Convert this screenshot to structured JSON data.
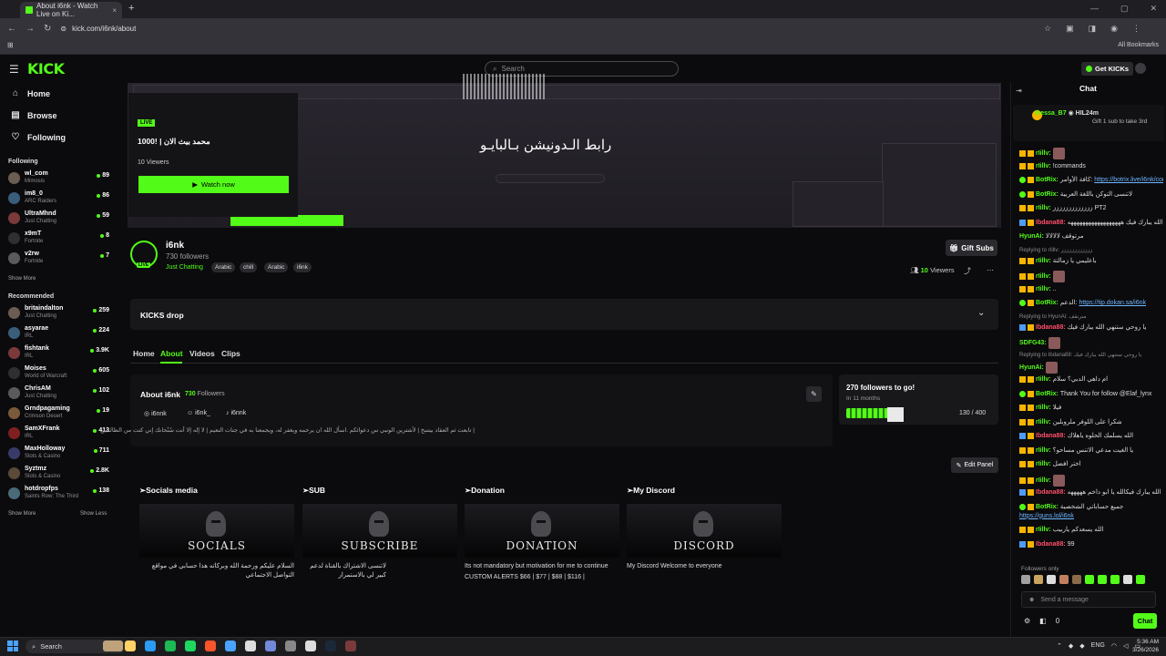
{
  "browser": {
    "tab_title": "About i6nk - Watch Live on Ki...",
    "tab_close": "×",
    "new_tab": "+",
    "url": "kick.com/i6nk/about",
    "all_bookmarks": "All Bookmarks",
    "window_controls": [
      "—",
      "▢",
      "✕"
    ]
  },
  "header": {
    "logo": "KICK",
    "search_placeholder": "Search",
    "get_kicks": "Get KICKs"
  },
  "sidebar": {
    "nav": [
      {
        "label": "Home",
        "icon": "home-icon"
      },
      {
        "label": "Browse",
        "icon": "browse-icon"
      },
      {
        "label": "Following",
        "icon": "heart-icon"
      }
    ],
    "following_heading": "Following",
    "following": [
      {
        "name": "wl_com",
        "game": "Mimosis",
        "viewers": "89"
      },
      {
        "name": "im8_0",
        "game": "ARC Raiders",
        "viewers": "86"
      },
      {
        "name": "UltraMhnd",
        "game": "Just Chatting",
        "viewers": "59"
      },
      {
        "name": "x9mT",
        "game": "Fortnite",
        "viewers": "8"
      },
      {
        "name": "v2rw",
        "game": "Fortnite",
        "viewers": "7"
      }
    ],
    "show_more": "Show More",
    "recommended_heading": "Recommended",
    "recommended": [
      {
        "name": "britaindalton",
        "game": "Just Chatting",
        "viewers": "259"
      },
      {
        "name": "asyarae",
        "game": "IRL",
        "viewers": "224"
      },
      {
        "name": "fishtank",
        "game": "IRL",
        "viewers": "3.9K"
      },
      {
        "name": "Moises",
        "game": "World of Warcraft",
        "viewers": "605"
      },
      {
        "name": "ChrisAM",
        "game": "Just Chatting",
        "viewers": "102"
      },
      {
        "name": "Grndpagaming",
        "game": "Crimson Desert",
        "viewers": "19"
      },
      {
        "name": "SamXFrank",
        "game": "IRL",
        "viewers": "413"
      },
      {
        "name": "MaxHolloway",
        "game": "Slots & Casino",
        "viewers": "711"
      },
      {
        "name": "Syztmz",
        "game": "Slots & Casino",
        "viewers": "2.8K"
      },
      {
        "name": "hotdropfps",
        "game": "Saints Row: The Third",
        "viewers": "138"
      }
    ],
    "show_more2": "Show More",
    "show_less": "Show Less"
  },
  "banner": {
    "live_badge": "LIVE",
    "stream_title": "1000! | محمد بيث الان",
    "viewers": "10 Viewers",
    "watch_now": "Watch now",
    "arabic_overlay": "رابط الـدونيشن بـالبايـو"
  },
  "channel": {
    "name": "i6nk",
    "followers": "730 followers",
    "live": "LIVE",
    "category": "Just Chatting",
    "tags": [
      "Arabic",
      "chill",
      "Arabic",
      "i6nk"
    ],
    "gift_subs": "Gift Subs",
    "viewers_count": "10",
    "viewers_label": "Viewers"
  },
  "kicks_drop": "KICKS drop",
  "tabs": [
    "Home",
    "About",
    "Videos",
    "Clips"
  ],
  "about": {
    "title": "About i6nk",
    "followers_num": "730",
    "followers_label": "Followers",
    "socials": [
      "i6nnk",
      "i6nk_",
      "i6nnk"
    ],
    "bio": "| تابعت ثم العقاد بيتنبخ | لأشترين الونبي س دعوائكم .اسأل الله ان يرحمه ويغفر له، ويجمعنا به في جنات النعيم | لا إله إلا أنت سُبْحانك إني كنت من الظالمين"
  },
  "goal": {
    "title": "270 followers to go!",
    "sub": "In 11 months",
    "progress": "130 / 400",
    "fraction": 0.325
  },
  "edit_panel": "Edit Panel",
  "panels": [
    {
      "title": "➢Socials media",
      "image_word": "SOCIALS",
      "desc": "السلام عليكم ورحمة الله وبركاته هذا حسابي في مواقع التواصل الاجتماعي"
    },
    {
      "title": "➢SUB",
      "image_word": "SUBSCRIBE",
      "desc": "لاتنسى الاشتراك بالقناة لدعم كبير لي بالاستمرار"
    },
    {
      "title": "➢Donation",
      "image_word": "DONATION",
      "desc": "Its not mandatory but motivation for me to continue",
      "desc2": "CUSTOM ALERTS $66 | $77 | $88 | $116 |"
    },
    {
      "title": "➢My Discord",
      "image_word": "DISCORD",
      "desc": "My Discord Welcome to everyone"
    }
  ],
  "chat": {
    "title": "Chat",
    "pinned_user": "Ihessa_B7",
    "pinned_gift": "HIL24m",
    "pinned_text": "Gift 1 sub to take 3rd",
    "messages": [
      {
        "user": "rIillv:",
        "text": "",
        "badge": "b1",
        "color": "#53fc18"
      },
      {
        "user": "rIillv:",
        "text": "!commands",
        "badge": "b1",
        "color": "#53fc18"
      },
      {
        "user": "BotRix:",
        "text": "كافة الأوامر:",
        "badge": "b3",
        "color": "#53fc18",
        "link": "https://botrix.live/i6nk/commands"
      },
      {
        "user": "BotRix:",
        "text": "لاتنسى التوكن باللغة العربية",
        "badge": "b3",
        "color": "#53fc18"
      },
      {
        "user": "rIillv:",
        "text": "ززززززززززززز PT2",
        "badge": "b1",
        "color": "#53fc18"
      },
      {
        "user": "Ibdana88:",
        "text": "الله يبارك فيك ههههههههههههههههههه",
        "badge": "b2",
        "color": "#ff4f6a"
      },
      {
        "user": "HyunAi:",
        "text": "مرتوقف لالالالا",
        "badge": "",
        "color": "#53fc18"
      },
      {
        "reply": "Replying to rIillv: زززززززززززز"
      },
      {
        "user": "rIillv:",
        "text": "باعليمي يا زمالتة",
        "badge": "b1",
        "color": "#53fc18"
      },
      {
        "user": "rIillv:",
        "text": "",
        "badge": "b1",
        "color": "#53fc18"
      },
      {
        "user": "rIillv:",
        "text": "..",
        "badge": "b1",
        "color": "#53fc18"
      },
      {
        "user": "BotRix:",
        "text": "الدعم:",
        "badge": "b3",
        "color": "#53fc18",
        "link": "https://tip.dokan.sa/i6nk"
      },
      {
        "reply": "Replying to HyunAi: مترنقف"
      },
      {
        "user": "Ibdana88:",
        "text": "يا روحي ستنهي الله يبارك فيك",
        "badge": "b2",
        "color": "#ff4f6a"
      },
      {
        "user": "SDFG43:",
        "text": "",
        "badge": "",
        "color": "#53fc18"
      },
      {
        "reply": "Replying to Ibdana88: يا روحي ستنهي الله يبارك فيك"
      },
      {
        "user": "HyunAi:",
        "text": "",
        "badge": "",
        "color": "#53fc18"
      },
      {
        "user": "rIillv:",
        "text": "ام داهي الدبي؟ سلام",
        "badge": "b1",
        "color": "#53fc18"
      },
      {
        "user": "BotRix:",
        "text": "Thank You for follow @Elaf_lynx",
        "badge": "b3",
        "color": "#53fc18"
      },
      {
        "user": "rIillv:",
        "text": "فيلا",
        "badge": "b1",
        "color": "#53fc18"
      },
      {
        "user": "rIillv:",
        "text": "شكرا على اللوفر ملروبلين",
        "badge": "b1",
        "color": "#53fc18"
      },
      {
        "user": "Ibdana88:",
        "text": "الله يسلمك الحلوه ياهلاك",
        "badge": "b2",
        "color": "#ff4f6a"
      },
      {
        "user": "rIillv:",
        "text": "يا الغيت مدعي الاتنس مساحو؟",
        "badge": "b1",
        "color": "#53fc18"
      },
      {
        "user": "rIillv:",
        "text": "اختر افضل",
        "badge": "b1",
        "color": "#53fc18"
      },
      {
        "user": "rIillv:",
        "text": "",
        "badge": "b1",
        "color": "#53fc18"
      },
      {
        "user": "Ibdana88:",
        "text": "الله يبارك فيكالله يا ابو داخم هههههه",
        "badge": "b2",
        "color": "#ff4f6a"
      },
      {
        "user": "BotRix:",
        "text": "جميع حساباتي الشخصية",
        "badge": "b3",
        "color": "#53fc18",
        "link2": "https://guns.lol/i6nk"
      },
      {
        "user": "rIillv:",
        "text": "الله يسعدكم ياربيب",
        "badge": "b1",
        "color": "#53fc18"
      },
      {
        "user": "Ibdana88:",
        "text": "99",
        "badge": "b2",
        "color": "#ff4f6a"
      }
    ],
    "followers_only": "Followers only",
    "send_placeholder": "Send a message",
    "footer_count": "0",
    "chat_button": "Chat"
  },
  "taskbar": {
    "search": "Search",
    "lang": "ENG",
    "time": "5:36 AM",
    "date": "3/26/2026"
  }
}
